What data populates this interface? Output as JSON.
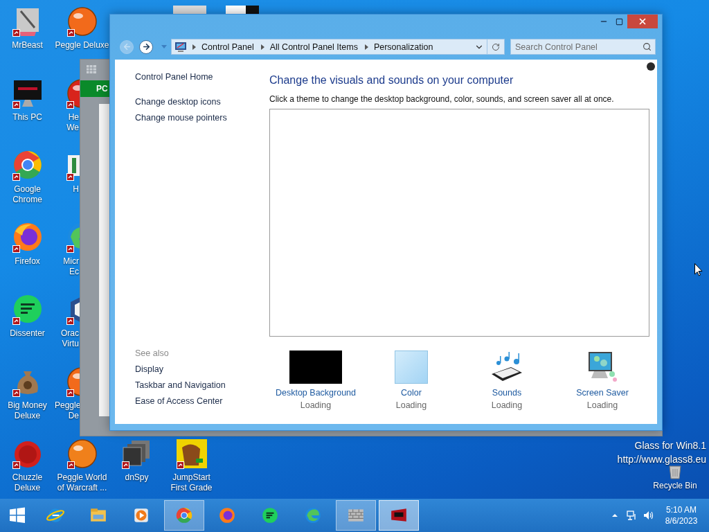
{
  "desktop": {
    "icons": [
      {
        "label_lines": [
          "MrBeast"
        ]
      },
      {
        "label_lines": [
          "This PC"
        ]
      },
      {
        "label_lines": [
          "Google",
          "Chrome"
        ]
      },
      {
        "label_lines": [
          "Firefox"
        ]
      },
      {
        "label_lines": [
          "Dissenter"
        ]
      },
      {
        "label_lines": [
          "Big Money",
          "Deluxe"
        ]
      },
      {
        "label_lines": [
          "Chuzzle",
          "Deluxe"
        ]
      },
      {
        "label_lines": [
          "Peggle Deluxe"
        ]
      },
      {
        "label_lines": [
          "He",
          "We"
        ]
      },
      {
        "label_lines": [
          "H"
        ]
      },
      {
        "label_lines": [
          "Micr",
          "Ec"
        ]
      },
      {
        "label_lines": [
          "Orac",
          "Virtu"
        ]
      },
      {
        "label_lines": [
          "Peggle",
          "De"
        ]
      },
      {
        "label_lines": [
          "Peggle World",
          "of Warcraft ..."
        ]
      },
      {
        "label_lines": [
          "dnSpy"
        ]
      },
      {
        "label_lines": [
          "JumpStart",
          "First Grade"
        ]
      }
    ],
    "overlay_text": [
      "Glass for Win8.1",
      "http://www.glass8.eu"
    ],
    "recycle_bin": {
      "label": "Recycle Bin"
    }
  },
  "background_window": {
    "header": "PC"
  },
  "window": {
    "nav": {
      "back_disabled": true,
      "forward_disabled": false
    },
    "breadcrumb": [
      "Control Panel",
      "All Control Panel Items",
      "Personalization"
    ],
    "search": {
      "placeholder": "Search Control Panel"
    },
    "sidebar": {
      "links": [
        "Control Panel Home",
        "Change desktop icons",
        "Change mouse pointers"
      ],
      "see_also": {
        "title": "See also",
        "links": [
          "Display",
          "Taskbar and Navigation",
          "Ease of Access Center"
        ]
      }
    },
    "main": {
      "heading": "Change the visuals and sounds on your computer",
      "description": "Click a theme to change the desktop background, color, sounds, and screen saver all at once.",
      "settings": [
        {
          "kind": "wallpaper",
          "label": "Desktop Background",
          "status": "Loading"
        },
        {
          "kind": "color",
          "label": "Color",
          "status": "Loading"
        },
        {
          "kind": "sounds",
          "label": "Sounds",
          "status": "Loading"
        },
        {
          "kind": "screensaver",
          "label": "Screen Saver",
          "status": "Loading"
        }
      ]
    }
  },
  "taskbar": {
    "buttons": [
      {
        "running": false,
        "selected": false
      },
      {
        "running": false,
        "selected": false
      },
      {
        "running": false,
        "selected": false
      },
      {
        "running": true,
        "selected": false
      },
      {
        "running": false,
        "selected": false
      },
      {
        "running": false,
        "selected": false
      },
      {
        "running": false,
        "selected": false
      },
      {
        "running": true,
        "selected": false
      },
      {
        "running": true,
        "selected": true
      }
    ],
    "clock": {
      "time": "5:10 AM",
      "date": "8/6/2023"
    }
  }
}
